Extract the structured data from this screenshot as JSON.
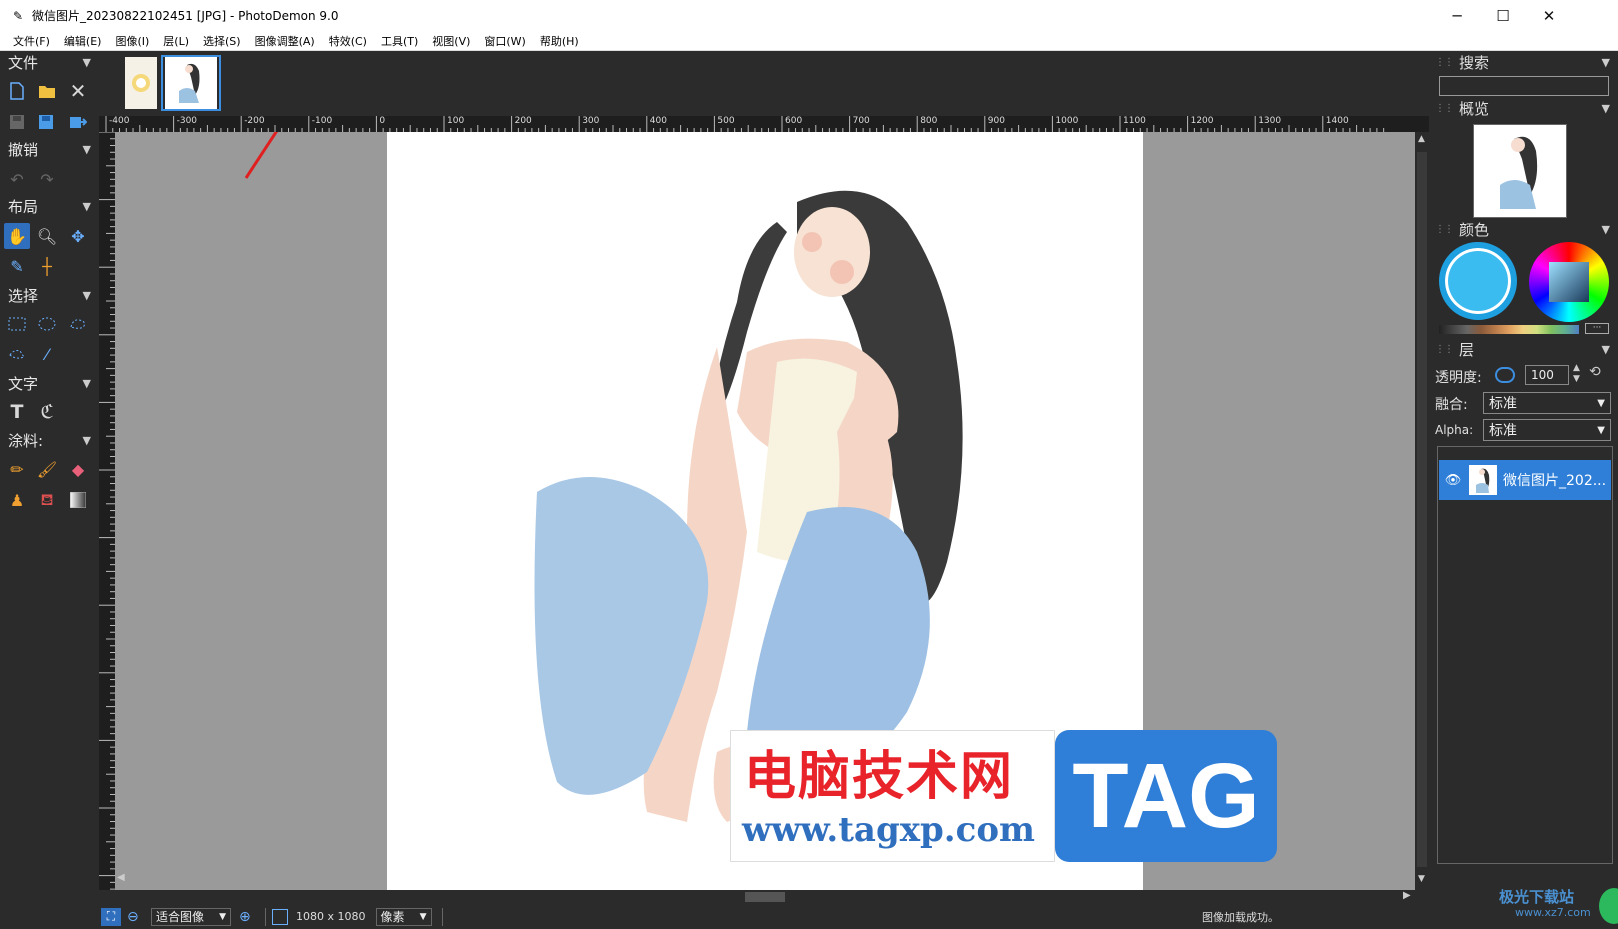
{
  "window": {
    "title": "微信图片_20230822102451 [JPG]  -  PhotoDemon 9.0",
    "minimize": "─",
    "maximize": "☐",
    "close": "✕"
  },
  "menu": [
    "文件(F)",
    "编辑(E)",
    "图像(I)",
    "层(L)",
    "选择(S)",
    "图像调整(A)",
    "特效(C)",
    "工具(T)",
    "视图(V)",
    "窗口(W)",
    "帮助(H)"
  ],
  "toolbox": {
    "file": "文件",
    "undo": "撤销",
    "layout": "布局",
    "select": "选择",
    "text": "文字",
    "paint": "涂料:"
  },
  "ruler": {
    "h_ticks": [
      "-400",
      "-300",
      "-200",
      "-100",
      "0",
      "100",
      "200",
      "300",
      "400",
      "500",
      "600",
      "700",
      "800",
      "900",
      "1000",
      "1100",
      "1200",
      "1300",
      "1400"
    ]
  },
  "status": {
    "zoom": "适合图像",
    "size": "1080 x 1080",
    "unit": "像素",
    "message": "图像加载成功。"
  },
  "right": {
    "search": "搜索",
    "overview": "概览",
    "color": "颜色",
    "layers": "层",
    "opacity_label": "透明度:",
    "opacity_value": "100",
    "blend_label": "融合:",
    "blend_value": "标准",
    "alpha_label": "Alpha:",
    "alpha_value": "标准",
    "layer_name": "微信图片_202..."
  },
  "watermark": {
    "title": "电脑技术网",
    "url": "www.tagxp.com",
    "tag": "TAG",
    "corner": "极光下载站",
    "corner_url": "www.xz7.com"
  },
  "colors": {
    "accent": "#2f7fd8",
    "arrow": "#e02020",
    "wm_red": "#e8232a",
    "wm_blue": "#2f7fd8"
  }
}
